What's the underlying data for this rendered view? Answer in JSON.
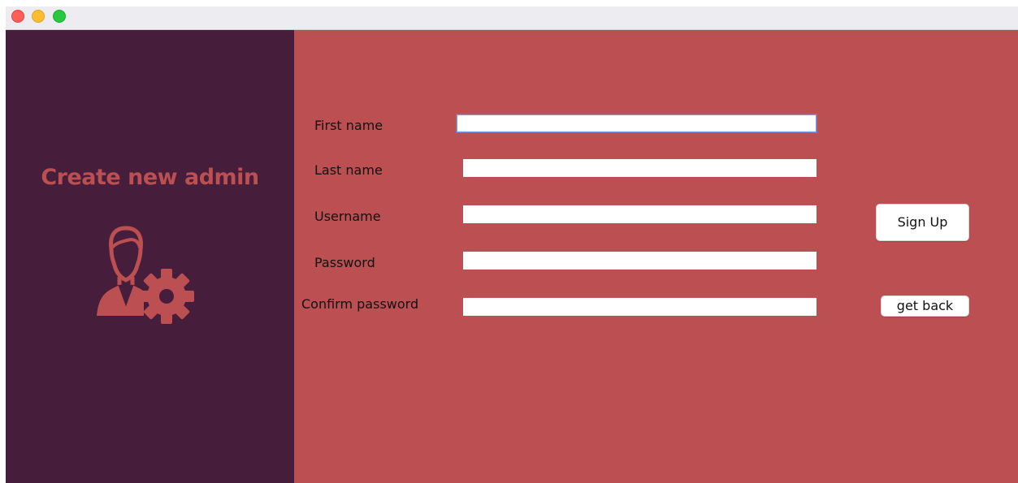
{
  "window": {
    "controls": [
      "close",
      "minimize",
      "maximize"
    ]
  },
  "sidebar": {
    "title": "Create new admin",
    "icon": "admin-settings-icon",
    "background": "#461d3b",
    "accent": "#bb4f51"
  },
  "form": {
    "background": "#bb4f51",
    "fields": {
      "first_name": {
        "label": "First name",
        "value": ""
      },
      "last_name": {
        "label": "Last name",
        "value": ""
      },
      "username": {
        "label": "Username",
        "value": ""
      },
      "password": {
        "label": "Password",
        "value": ""
      },
      "confirm_password": {
        "label": "Confirm password",
        "value": ""
      }
    },
    "buttons": {
      "sign_up": "Sign Up",
      "get_back": "get back"
    }
  }
}
